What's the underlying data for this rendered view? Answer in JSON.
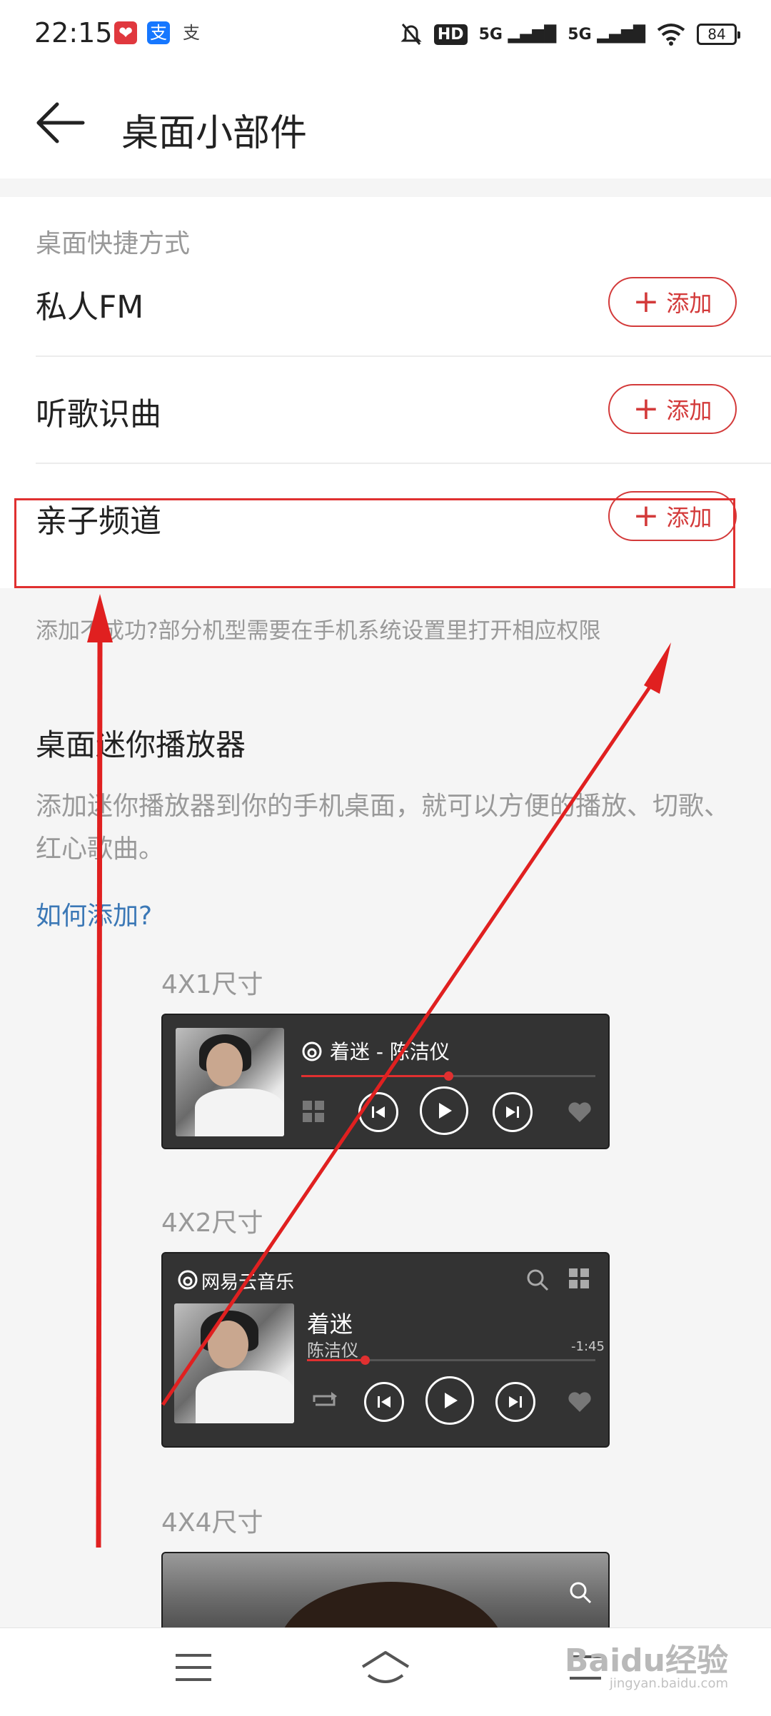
{
  "status_bar": {
    "time": "22:15",
    "apps": [
      "pinduoduo-icon",
      "alipay-icon",
      "alipay-outline-icon"
    ],
    "hd_label": "HD",
    "signal1": "5G",
    "signal2": "5G",
    "battery": "84"
  },
  "header": {
    "title": "桌面小部件"
  },
  "shortcuts": {
    "section_label": "桌面快捷方式",
    "add_label": "添加",
    "items": [
      {
        "label": "私人FM"
      },
      {
        "label": "听歌识曲"
      },
      {
        "label": "亲子频道"
      }
    ],
    "tip": "添加不成功?部分机型需要在手机系统设置里打开相应权限"
  },
  "mini_player": {
    "title": "桌面迷你播放器",
    "description": "添加迷你播放器到你的手机桌面，就可以方便的播放、切歌、红心歌曲。",
    "how_link": "如何添加?",
    "size_4x1": "4X1尺寸",
    "size_4x2": "4X2尺寸",
    "size_4x4": "4X4尺寸",
    "widget_4x1": {
      "song_line": "着迷 - 陈洁仪",
      "progress": 0.5
    },
    "widget_4x2": {
      "brand": "网易云音乐",
      "song": "着迷",
      "artist": "陈洁仪",
      "remaining": "-1:45",
      "progress": 0.2
    }
  },
  "watermark": {
    "main": "Baidu经验",
    "sub": "jingyan.baidu.com"
  },
  "colors": {
    "accent": "#d33a3a",
    "link": "#3b78b6",
    "annotation": "#e03030",
    "widget_bg": "#333333"
  }
}
